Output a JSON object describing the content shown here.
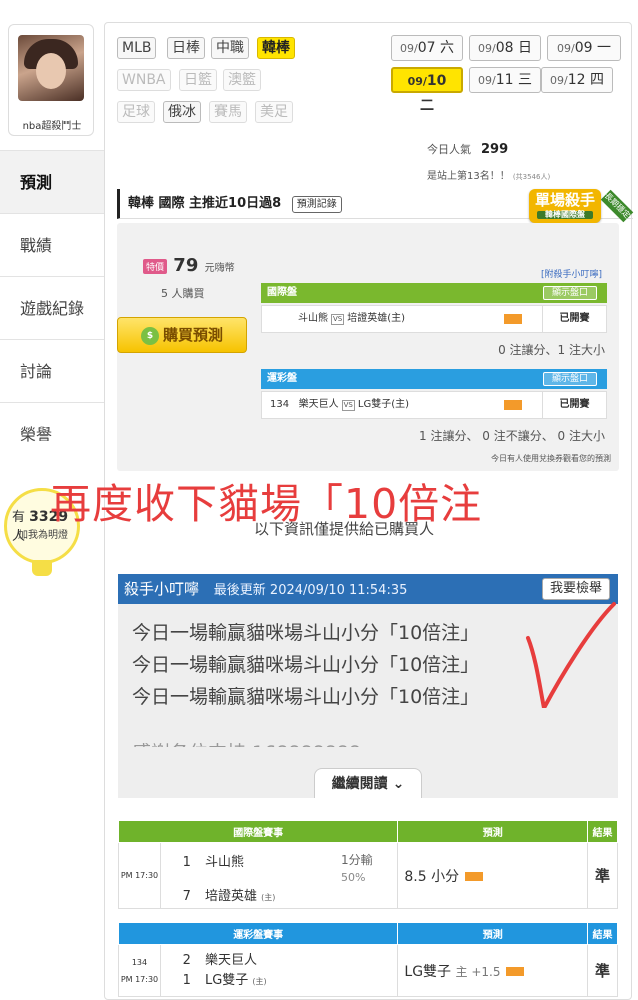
{
  "profile": {
    "username": "nba超殺鬥士"
  },
  "sidebar": {
    "items": [
      "預測",
      "戰績",
      "遊戲紀錄",
      "討論",
      "榮譽"
    ]
  },
  "fans": {
    "prefix": "有",
    "count": "3329",
    "suffix": "人",
    "add": "加我為明燈"
  },
  "sport_tags": [
    {
      "label": "MLB",
      "state": "normal"
    },
    {
      "label": "日棒",
      "state": "normal"
    },
    {
      "label": "中職",
      "state": "normal"
    },
    {
      "label": "韓棒",
      "state": "selected"
    },
    {
      "label": "WNBA",
      "state": "dim"
    },
    {
      "label": "日籃",
      "state": "dim"
    },
    {
      "label": "澳籃",
      "state": "dim"
    },
    {
      "label": "足球",
      "state": "dim"
    },
    {
      "label": "俄冰",
      "state": "normal"
    },
    {
      "label": "賽馬",
      "state": "dim"
    },
    {
      "label": "美足",
      "state": "dim"
    }
  ],
  "dates": [
    {
      "md": "09/",
      "d": "07",
      "w": "六"
    },
    {
      "md": "09/",
      "d": "08",
      "w": "日"
    },
    {
      "md": "09/",
      "d": "09",
      "w": "一"
    },
    {
      "md": "09/",
      "d": "10",
      "w": "二"
    },
    {
      "md": "09/",
      "d": "11",
      "w": "三"
    },
    {
      "md": "09/",
      "d": "12",
      "w": "四"
    }
  ],
  "stats": {
    "pop_label": "今日人氣",
    "pop_value": "299",
    "rank": "是站上第13名！！",
    "rank_sub": "(共3546人)"
  },
  "header": {
    "title": "韓棒 國際 主推近10日過8",
    "record_btn": "預測記錄"
  },
  "badge": {
    "title": "單場殺手",
    "sub": "韓棒國際盤",
    "ribbon": "長期穩定"
  },
  "purchase": {
    "hot": "特價",
    "price": "79",
    "unit": "元嗨幣",
    "buyers": "5 人購買",
    "button": "購買預測",
    "tip_link": "[附殺手小叮嚀]"
  },
  "bet_intl": {
    "head": "國際盤",
    "show": "顯示盤口",
    "teams": "斗山熊",
    "vs": "VS",
    "opp": "培證英雄(主)",
    "status": "已開賽",
    "summary": "0 注讓分、1 注大小"
  },
  "bet_lottery": {
    "head": "運彩盤",
    "show": "顯示盤口",
    "num": "134",
    "teams": "樂天巨人",
    "vs": "VS",
    "opp": "LG雙子(主)",
    "status": "已開賽",
    "summary": "1 注讓分、 0 注不讓分、 0 注大小",
    "note": "今日有人使用兌換券觀看您的預測"
  },
  "overlay": "再度收下貓場「10倍注",
  "info_line": "以下資訊僅提供給已購買人",
  "tip": {
    "title": "殺手小叮嚀",
    "updated": "最後更新 2024/09/10 11:54:35",
    "report": "我要檢舉",
    "lines": [
      "今日一場輸贏貓咪場斗山小分「10倍注」",
      "今日一場輸贏貓咪場斗山小分「10倍注」",
      "今日一場輸贏貓咪場斗山小分「10倍注」"
    ],
    "cut_line": "感謝各位支持 168888888",
    "continue": "繼續閱讀"
  },
  "table_intl": {
    "cols": [
      "國際盤賽事",
      "預測",
      "結果"
    ],
    "time": "PM 17:30",
    "away_no": "1",
    "away": "斗山熊",
    "home_no": "7",
    "home": "培證英雄",
    "home_mark": "(主)",
    "line": "1分輸",
    "pct": "50%",
    "pred": "8.5 小分",
    "result": "準"
  },
  "table_lottery": {
    "cols": [
      "運彩盤賽事",
      "預測",
      "結果"
    ],
    "num": "134",
    "time": "PM 17:30",
    "away_no": "2",
    "away": "樂天巨人",
    "home_no": "1",
    "home": "LG雙子",
    "home_mark": "(主)",
    "pred": "LG雙子",
    "pred_sub": "主 +1.5",
    "result": "準"
  },
  "colors": {
    "accent_yellow": "#ffe400",
    "green": "#6fb32b",
    "blue": "#2196de",
    "overlay_red": "#e73d3d"
  }
}
